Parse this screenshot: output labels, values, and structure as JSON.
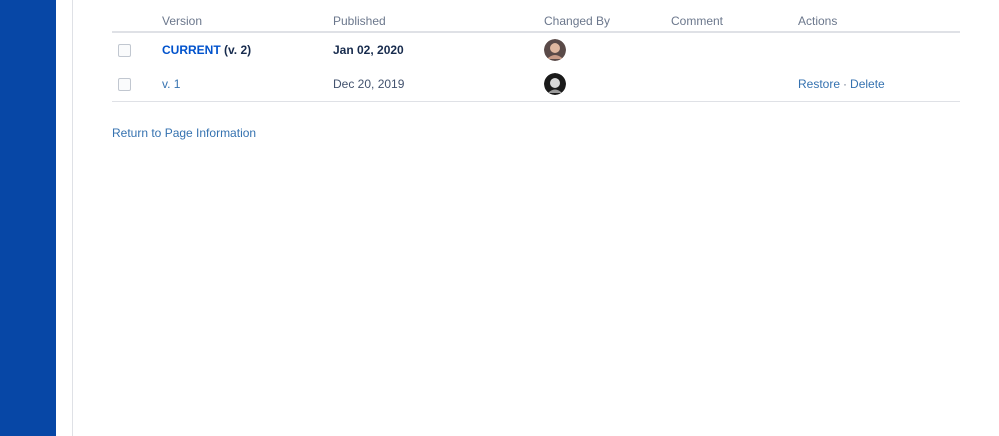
{
  "table": {
    "headers": {
      "version": "Version",
      "published": "Published",
      "changed_by": "Changed By",
      "comment": "Comment",
      "actions": "Actions"
    },
    "rows": [
      {
        "version_link": "CURRENT",
        "version_suffix": "(v. 2)",
        "published": "Jan 02, 2020",
        "comment": "",
        "restore": "",
        "separator": "",
        "delete": ""
      },
      {
        "version_link": "v. 1",
        "version_suffix": "",
        "published": "Dec 20, 2019",
        "comment": "",
        "restore": "Restore",
        "separator": "·",
        "delete": "Delete"
      }
    ]
  },
  "footer": {
    "return_link": "Return to Page Information"
  },
  "colors": {
    "sidebar": "#0747a6",
    "link": "#0052cc"
  }
}
